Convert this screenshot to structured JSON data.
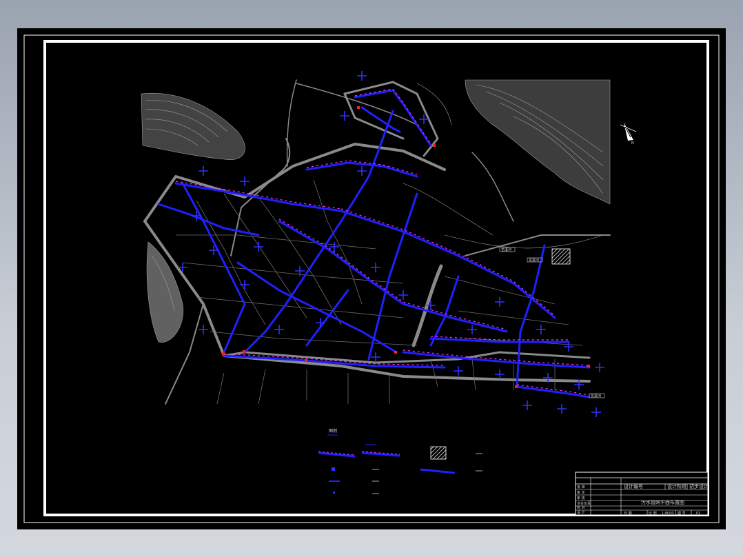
{
  "colors": {
    "background": "#000000",
    "border": "#ffffff",
    "road": "#8a8a8a",
    "terrain": "#a0a0a0",
    "pipe": "#2020ff",
    "label": "#ff33ff",
    "node": "#ff2020"
  },
  "map": {
    "north_label": "N",
    "road_labels": [
      "花溪河",
      "花溪河",
      "花溪河"
    ]
  },
  "legend": {
    "title": "图例"
  },
  "title_block": {
    "left_labels": [
      "批 准",
      "审 定",
      "审 核",
      "专业负责",
      "校 对",
      "设 计"
    ],
    "header_cells": [
      "设计编号",
      "设计阶段",
      "初步设计"
    ],
    "drawing_title": "污水管网平面布置图",
    "footer_cells": [
      "日 期",
      "比 例",
      "1:8000",
      "图 号",
      "01"
    ]
  }
}
